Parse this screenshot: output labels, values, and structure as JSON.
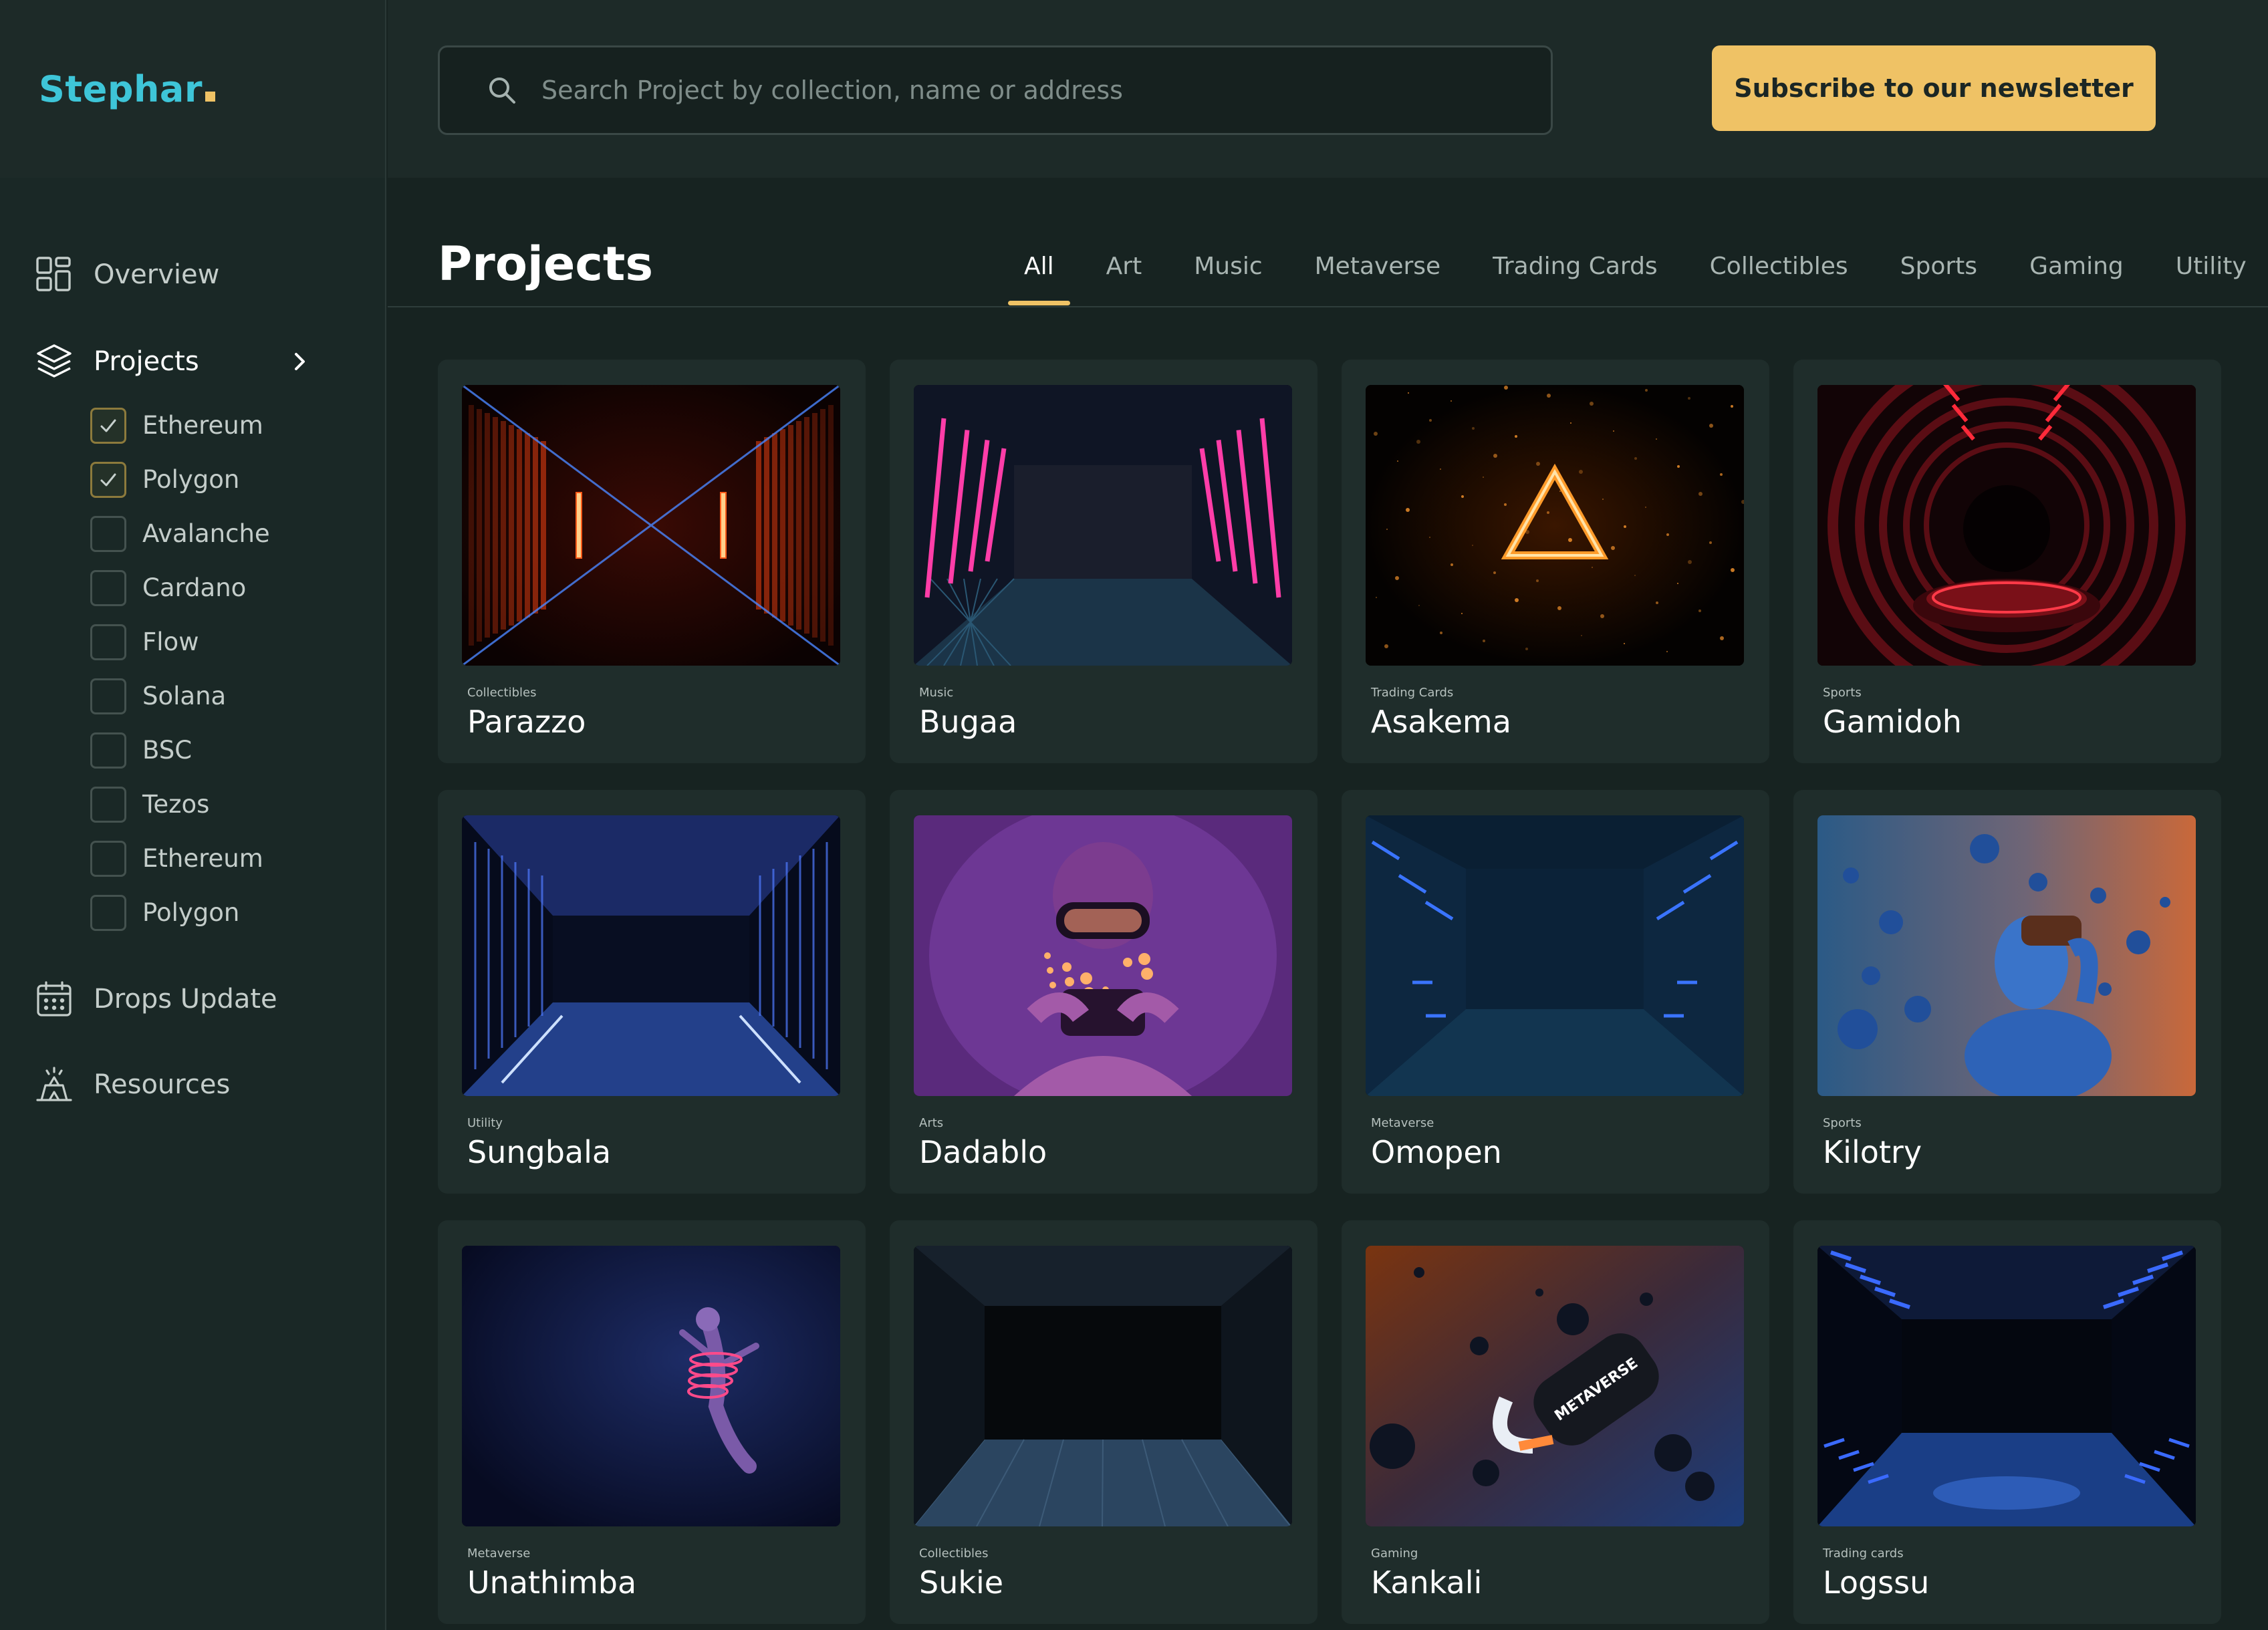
{
  "brand": {
    "name": "Stephar",
    "accent": "#efc265",
    "logo_color": "#3ec5d8"
  },
  "search": {
    "placeholder": "Search Project by collection, name or address"
  },
  "subscribe_label": "Subscribe to our newsletter",
  "sidebar": {
    "overview": "Overview",
    "projects": "Projects",
    "chains": [
      {
        "label": "Ethereum",
        "checked": true
      },
      {
        "label": "Polygon",
        "checked": true
      },
      {
        "label": "Avalanche",
        "checked": false
      },
      {
        "label": "Cardano",
        "checked": false
      },
      {
        "label": "Flow",
        "checked": false
      },
      {
        "label": "Solana",
        "checked": false
      },
      {
        "label": "BSC",
        "checked": false
      },
      {
        "label": "Tezos",
        "checked": false
      },
      {
        "label": "Ethereum",
        "checked": false
      },
      {
        "label": "Polygon",
        "checked": false
      }
    ],
    "drops": "Drops Update",
    "resources": "Resources"
  },
  "main": {
    "title": "Projects",
    "tabs": [
      "All",
      "Art",
      "Music",
      "Metaverse",
      "Trading Cards",
      "Collectibles",
      "Sports",
      "Gaming",
      "Utility"
    ],
    "active_tab": "All",
    "projects": [
      {
        "category": "Collectibles",
        "name": "Parazzo",
        "art": "red-corridor"
      },
      {
        "category": "Music",
        "name": "Bugaa",
        "art": "pink-neon-hall"
      },
      {
        "category": "Trading Cards",
        "name": "Asakema",
        "art": "glowing-triangle"
      },
      {
        "category": "Sports",
        "name": "Gamidoh",
        "art": "red-ring-tunnel"
      },
      {
        "category": "Utility",
        "name": "Sungbala",
        "art": "blue-hangar"
      },
      {
        "category": "Arts",
        "name": "Dadablo",
        "art": "vr-headset-gamer"
      },
      {
        "category": "Metaverse",
        "name": "Omopen",
        "art": "blue-light-room"
      },
      {
        "category": "Sports",
        "name": "Kilotry",
        "art": "blue-bust-spheres"
      },
      {
        "category": "Metaverse",
        "name": "Unathimba",
        "art": "floating-vr-figure"
      },
      {
        "category": "Collectibles",
        "name": "Sukie",
        "art": "dark-hangar"
      },
      {
        "category": "Gaming",
        "name": "Kankali",
        "art": "metaverse-headset"
      },
      {
        "category": "Trading cards",
        "name": "Logssu",
        "art": "blue-tunnel"
      }
    ]
  }
}
